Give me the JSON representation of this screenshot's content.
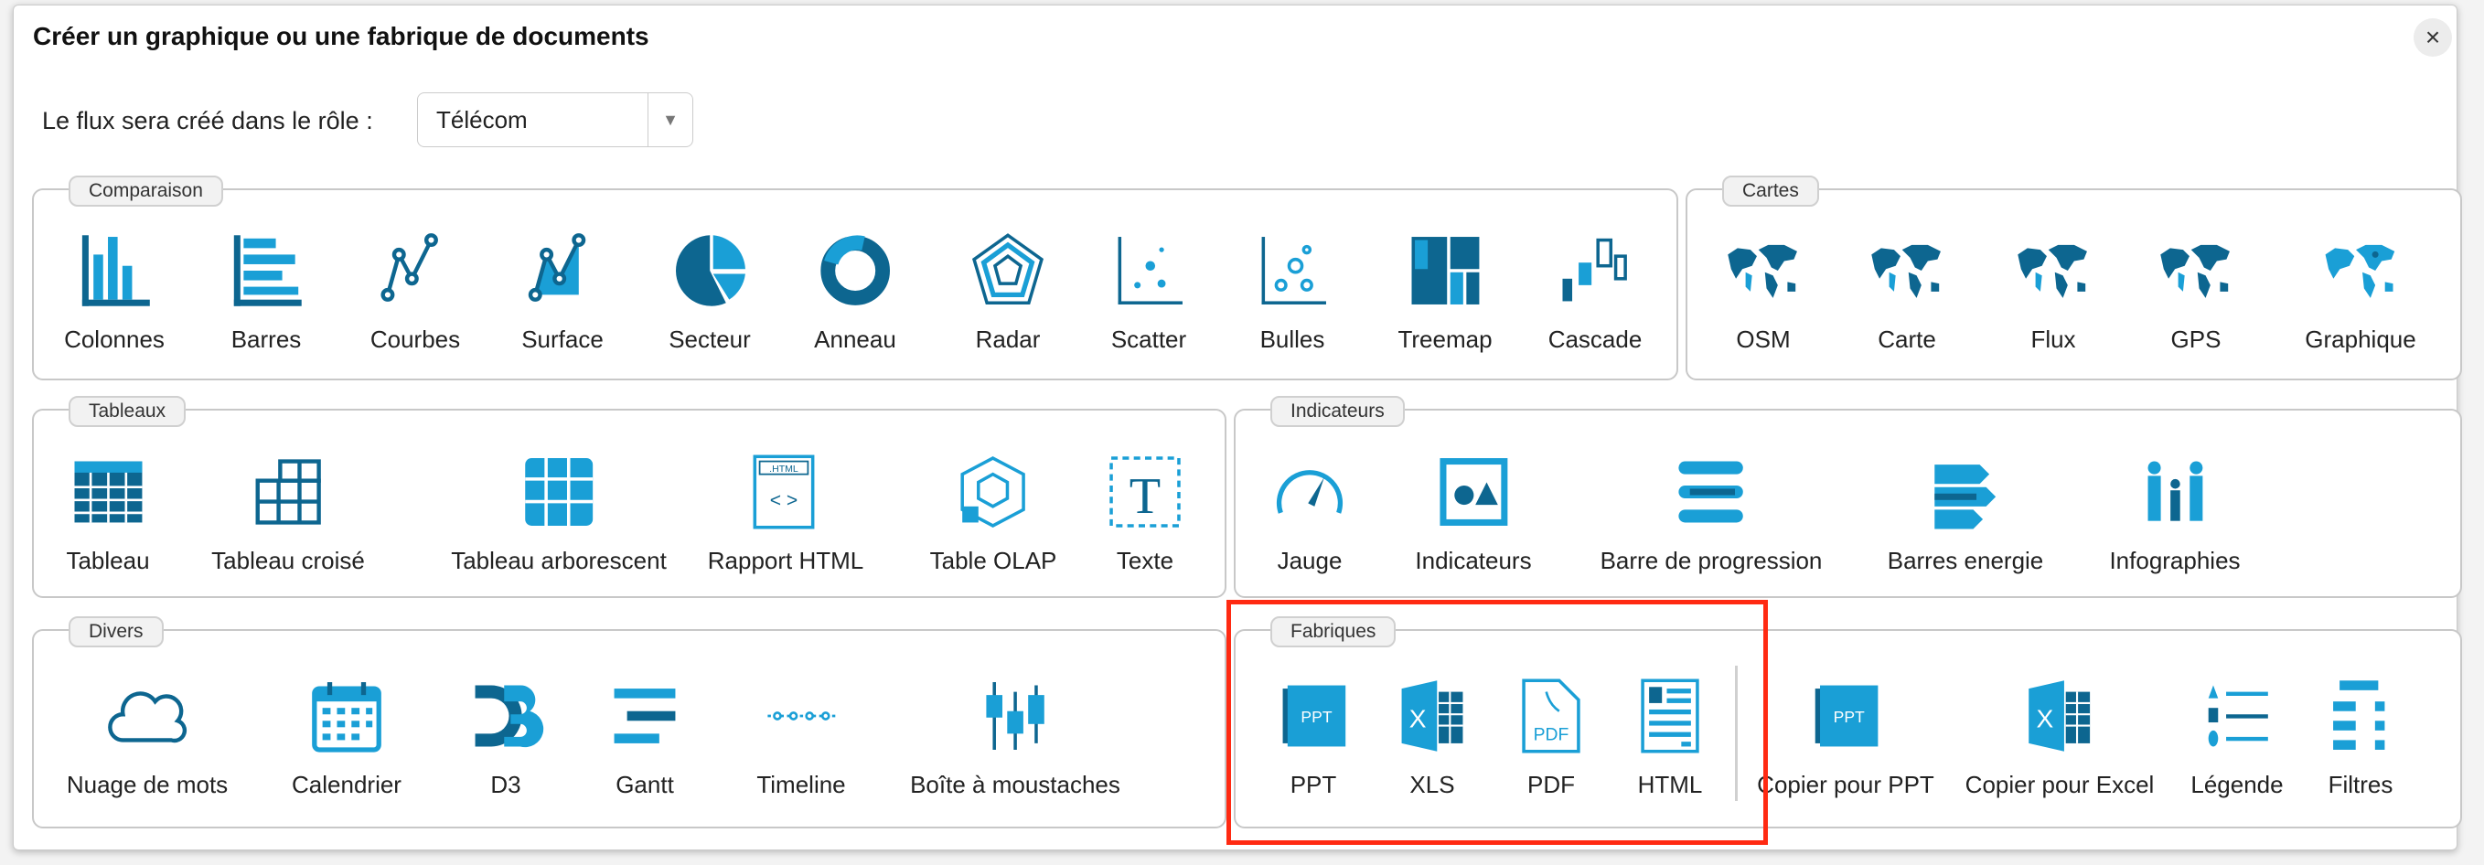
{
  "dialog": {
    "title": "Créer un graphique ou une fabrique de documents",
    "close_icon": "close-icon",
    "role_label": "Le flux sera créé dans le rôle :",
    "role_value": "Télécom"
  },
  "colors": {
    "accent": "#1a9fd6",
    "dark": "#0d6690",
    "highlight": "#ff2a12"
  },
  "sections": {
    "comparaison": {
      "title": "Comparaison",
      "items": [
        "Colonnes",
        "Barres",
        "Courbes",
        "Surface",
        "Secteur",
        "Anneau",
        "Radar",
        "Scatter",
        "Bulles",
        "Treemap",
        "Cascade"
      ]
    },
    "cartes": {
      "title": "Cartes",
      "items": [
        "OSM",
        "Carte",
        "Flux",
        "GPS",
        "Graphique"
      ]
    },
    "tableaux": {
      "title": "Tableaux",
      "items": [
        "Tableau",
        "Tableau croisé",
        "Tableau arborescent",
        "Rapport HTML",
        "Table OLAP",
        "Texte"
      ]
    },
    "indicateurs": {
      "title": "Indicateurs",
      "items": [
        "Jauge",
        "Indicateurs",
        "Barre de progression",
        "Barres energie",
        "Infographies"
      ]
    },
    "divers": {
      "title": "Divers",
      "items": [
        "Nuage de mots",
        "Calendrier",
        "D3",
        "Gantt",
        "Timeline",
        "Boîte à moustaches"
      ]
    },
    "fabriques": {
      "title": "Fabriques",
      "items": [
        "PPT",
        "XLS",
        "PDF",
        "HTML",
        "Copier pour PPT",
        "Copier pour Excel",
        "Légende",
        "Filtres"
      ]
    }
  }
}
